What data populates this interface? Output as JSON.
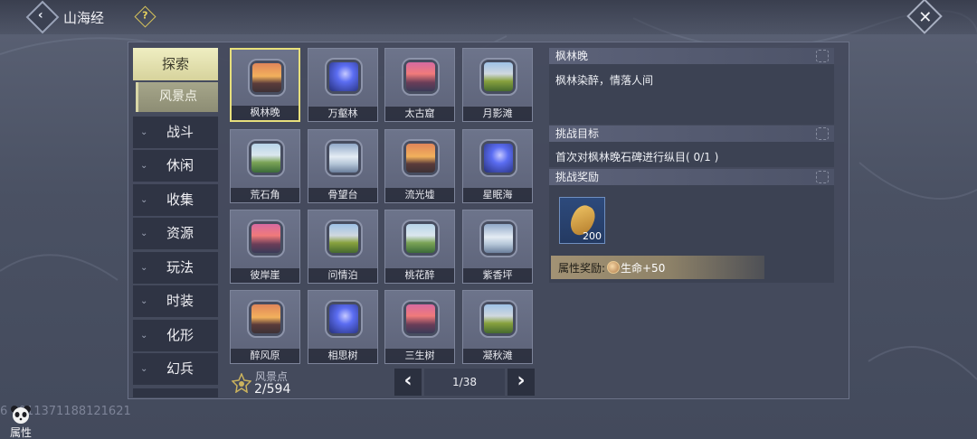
{
  "header": {
    "title": "山海经",
    "back_icon": "chevron-left-icon",
    "help_icon": "question-mark-icon",
    "close_icon": "close-icon"
  },
  "sidebar": {
    "active_tab": "探索",
    "active_subtab": "风景点",
    "tabs": [
      {
        "label": "战斗"
      },
      {
        "label": "休闲"
      },
      {
        "label": "收集"
      },
      {
        "label": "资源"
      },
      {
        "label": "玩法"
      },
      {
        "label": "时装"
      },
      {
        "label": "化形"
      },
      {
        "label": "幻兵"
      }
    ]
  },
  "grid": {
    "selected": "枫林晚",
    "items": [
      {
        "name": "枫林晚",
        "img": "sunset"
      },
      {
        "name": "万壑林",
        "img": "blue"
      },
      {
        "name": "太古窟",
        "img": "pink"
      },
      {
        "name": "月影滩",
        "img": "meadow"
      },
      {
        "name": "荒石角",
        "img": "green"
      },
      {
        "name": "骨望台",
        "img": "snow"
      },
      {
        "name": "流光墟",
        "img": "sunset"
      },
      {
        "name": "星眠海",
        "img": "blue"
      },
      {
        "name": "彼岸崖",
        "img": "pink"
      },
      {
        "name": "问情泊",
        "img": "meadow"
      },
      {
        "name": "桃花醉",
        "img": "green"
      },
      {
        "name": "紫香坪",
        "img": "snow"
      },
      {
        "name": "醉风原",
        "img": "sunset"
      },
      {
        "name": "相思树",
        "img": "blue"
      },
      {
        "name": "三生树",
        "img": "pink"
      },
      {
        "name": "凝秋滩",
        "img": "meadow"
      }
    ]
  },
  "counter": {
    "label": "风景点",
    "value": "2/594"
  },
  "pagination": {
    "page": "1/38",
    "prev": "‹",
    "next": "›"
  },
  "detail": {
    "name": "枫林晚",
    "description": "枫林染醉，情落人间",
    "goal_header": "挑战目标",
    "goal_text": "首次对枫林晚石碑进行纵目( 0/1 )",
    "reward_header": "挑战奖励",
    "reward_qty": "200",
    "attr_label": "属性奖励:",
    "attr_value": "生命+50"
  },
  "footer": {
    "uid": "6   0011371188121621",
    "attr_label": "属性"
  }
}
